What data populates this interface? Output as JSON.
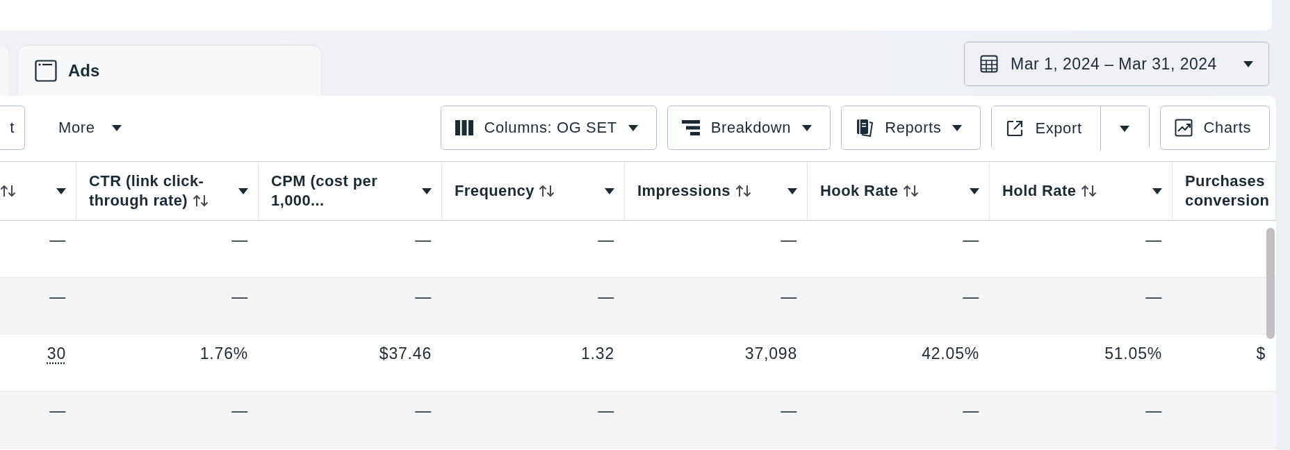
{
  "tabs": [
    {
      "label": "Ads",
      "selected": true
    }
  ],
  "date_range": {
    "label": "Mar 1, 2024 – Mar 31, 2024"
  },
  "toolbar": {
    "left": [
      {
        "kind": "outlined",
        "label": "t"
      },
      {
        "kind": "plain",
        "label": "More",
        "caret": true
      }
    ],
    "right": [
      {
        "kind": "columns",
        "label": "Columns: OG SET",
        "caret": true
      },
      {
        "kind": "breakdown",
        "label": "Breakdown",
        "caret": true
      },
      {
        "kind": "reports",
        "label": "Reports",
        "caret": true
      },
      {
        "kind": "export",
        "label": "Export",
        "split": true
      },
      {
        "kind": "charts",
        "label": "Charts"
      }
    ]
  },
  "table": {
    "columns": [
      {
        "sortable": true,
        "menu": true
      },
      {
        "label": "CTR (link click-through rate)",
        "sortable": true,
        "menu": true
      },
      {
        "label": "CPM (cost per 1,000...",
        "sortable": false,
        "menu": true
      },
      {
        "label": "Frequency",
        "sortable": true,
        "menu": true
      },
      {
        "label": "Impressions",
        "sortable": true,
        "menu": true
      },
      {
        "label": "Hook Rate",
        "sortable": true,
        "menu": true
      },
      {
        "label": "Hold Rate",
        "sortable": true,
        "menu": true
      },
      {
        "label": "Purchases conversion",
        "sortable": false,
        "menu": false
      }
    ],
    "rows": [
      {
        "first_cell_dotted": false,
        "cells": [
          "—",
          "—",
          "—",
          "—",
          "—",
          "—",
          "—"
        ]
      },
      {
        "first_cell_dotted": false,
        "cells": [
          "—",
          "—",
          "—",
          "—",
          "—",
          "—",
          "—"
        ]
      },
      {
        "first_cell_dotted": true,
        "cells": [
          "30",
          "1.76%",
          "$37.46",
          "1.32",
          "37,098",
          "42.05%",
          "51.05%",
          "$"
        ]
      },
      {
        "first_cell_dotted": false,
        "cells": [
          "—",
          "—",
          "—",
          "—",
          "—",
          "—",
          "—"
        ]
      }
    ]
  }
}
